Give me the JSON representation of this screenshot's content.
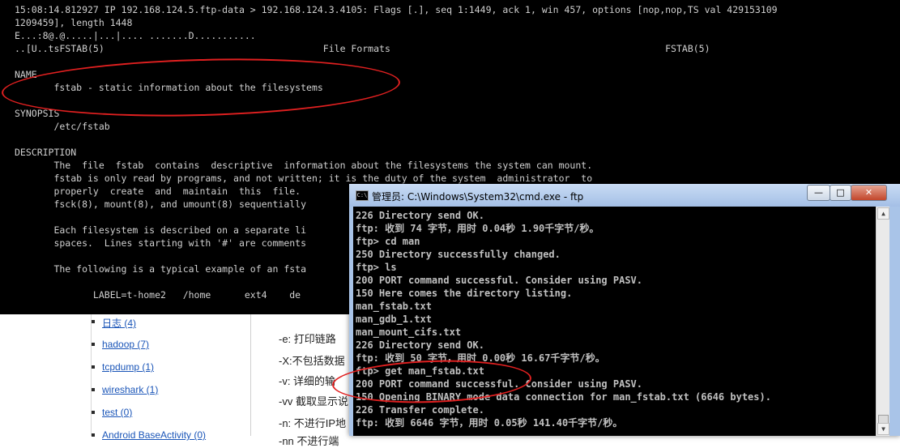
{
  "terminal": {
    "lines": [
      "15:08:14.812927 IP 192.168.124.5.ftp-data > 192.168.124.3.4105: Flags [.], seq 1:1449, ack 1, win 457, options [nop,nop,TS val 429153109",
      "1209459], length 1448",
      "E...:8@.@.....|...|.... .......D...........",
      "..[U..tsFSTAB(5)                                       File Formats                                                 FSTAB(5)",
      "",
      "NAME",
      "       fstab - static information about the filesystems",
      "",
      "SYNOPSIS",
      "       /etc/fstab",
      "",
      "DESCRIPTION",
      "       The  file  fstab  contains  descriptive  information about the filesystems the system can mount.",
      "       fstab is only read by programs, and not written; it is the duty of the system  administrator  to",
      "       properly  create  and  maintain  this  file.",
      "       fsck(8), mount(8), and umount(8) sequentially",
      "",
      "       Each filesystem is described on a separate li",
      "       spaces.  Lines starting with '#' are comments",
      "",
      "       The following is a typical example of an fsta",
      "",
      "              LABEL=t-home2   /home      ext4    de"
    ]
  },
  "webpage": {
    "categories": [
      "日志 (4)",
      "hadoop (7)",
      "tcpdump (1)",
      "wireshark (1)",
      "test (0)",
      "Android BaseActivity (0)"
    ],
    "options": [
      "-e: 打印链路",
      "-X:不包括数据",
      "-v: 详细的输",
      "-vv 截取显示说",
      "-n: 不进行IP地",
      "-nn 不进行端"
    ]
  },
  "cmd_window": {
    "title": "管理员: C:\\Windows\\System32\\cmd.exe - ftp",
    "icon": "C:\\",
    "buttons": {
      "minimize": "—",
      "maximize": "□",
      "close": "✕"
    },
    "lines": [
      "226 Directory send OK.",
      "ftp: 收到 74 字节，用时 0.04秒 1.90千字节/秒。",
      "ftp> cd man",
      "250 Directory successfully changed.",
      "ftp> ls",
      "200 PORT command successful. Consider using PASV.",
      "150 Here comes the directory listing.",
      "man_fstab.txt",
      "man_gdb_1.txt",
      "man_mount_cifs.txt",
      "226 Directory send OK.",
      "ftp: 收到 50 字节，用时 0.00秒 16.67千字节/秒。",
      "ftp> get man_fstab.txt",
      "200 PORT command successful. Consider using PASV.",
      "150 Opening BINARY mode data connection for man_fstab.txt (6646 bytes).",
      "226 Transfer complete.",
      "ftp: 收到 6646 字节，用时 0.05秒 141.40千字节/秒。"
    ],
    "scrollbar": {
      "up": "▲",
      "down": "▼"
    }
  },
  "colors": {
    "annotation": "#e12020",
    "terminal_bg": "#000000",
    "link": "#1a55b8"
  }
}
